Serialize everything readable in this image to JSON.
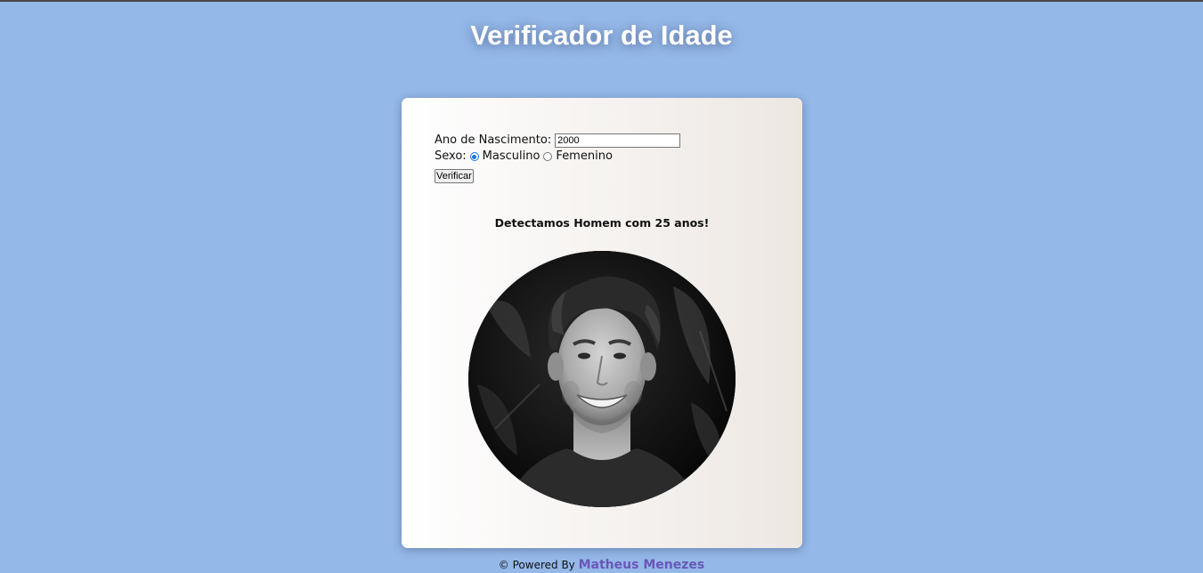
{
  "header": {
    "title": "Verificador de Idade"
  },
  "form": {
    "birth_year_label": "Ano de Nascimento:",
    "birth_year_value": "2000",
    "sex_label": "Sexo:",
    "options": [
      {
        "label": "Masculino",
        "checked": true
      },
      {
        "label": "Femenino",
        "checked": false
      }
    ],
    "verify_button": "Verificar"
  },
  "result": {
    "message": "Detectamos Homem com 25 anos!"
  },
  "footer": {
    "prefix": "© Powered By",
    "author": "Matheus Menezes"
  },
  "colors": {
    "background": "#94b8e8",
    "author_link": "#6a57b8",
    "radio_accent": "#1a73e8"
  }
}
